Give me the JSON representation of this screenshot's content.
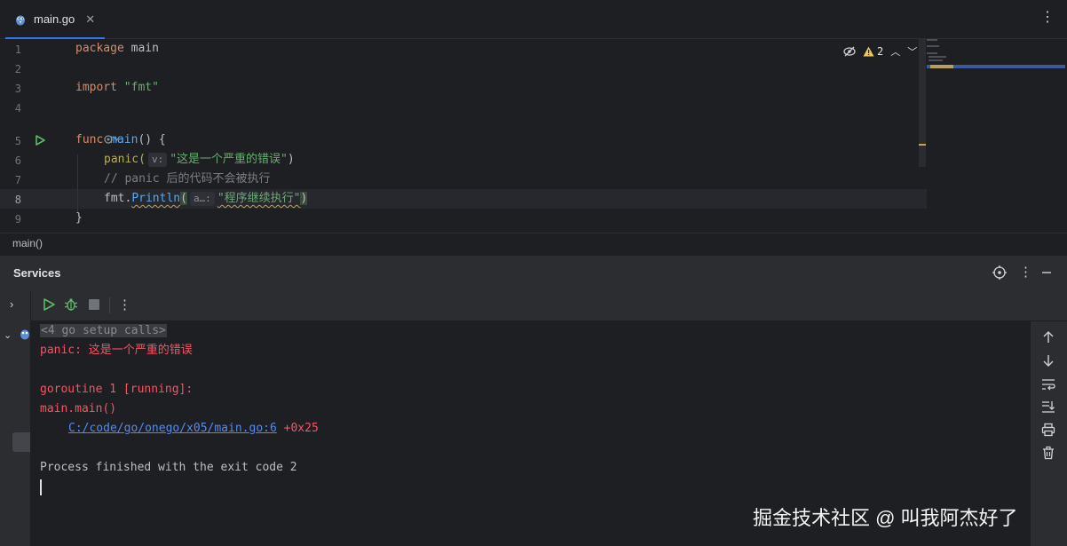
{
  "tab": {
    "filename": "main.go",
    "close": "✕",
    "more": "⋮"
  },
  "editor": {
    "line_numbers": [
      "1",
      "2",
      "3",
      "4",
      "5",
      "6",
      "7",
      "8",
      "9"
    ],
    "lines": {
      "l1_kw": "package",
      "l1_name": " main",
      "l3_kw": "import",
      "l3_str": " \"fmt\"",
      "l5_kw": "func",
      "l5_fn": " main",
      "l5_rest": "() {",
      "l6_fn": "panic(",
      "l6_hint": "v:",
      "l6_str": "\"这是一个严重的错误\"",
      "l6_end": ")",
      "l7_comment": "// panic 后的代码不会被执行",
      "l8_pkg": "fmt.",
      "l8_fn": "Println",
      "l8_paren": "(",
      "l8_hint": "a…:",
      "l8_str": "\"程序继续执行\"",
      "l8_end": ")",
      "l9": "}"
    },
    "inspection": {
      "warning_count": "2"
    }
  },
  "breadcrumb": {
    "item": "main()"
  },
  "services": {
    "title": "Services"
  },
  "console": {
    "setup_calls": "<4 go setup calls>",
    "panic_prefix": "panic: ",
    "panic_msg": "这是一个严重的错误",
    "goroutine": "goroutine 1 [running]:",
    "frame": "main.main()",
    "path_link": "C:/code/go/onego/x05/main.go:6",
    "offset": " +0x25",
    "finished": "Process finished with the exit code 2"
  },
  "watermark": "掘金技术社区 @ 叫我阿杰好了",
  "colors": {
    "accent": "#3574f0",
    "error": "#f75464",
    "link": "#548af7",
    "string": "#6aab73",
    "keyword": "#cf8e6d",
    "function": "#56a8f5",
    "run": "#5fb865"
  }
}
